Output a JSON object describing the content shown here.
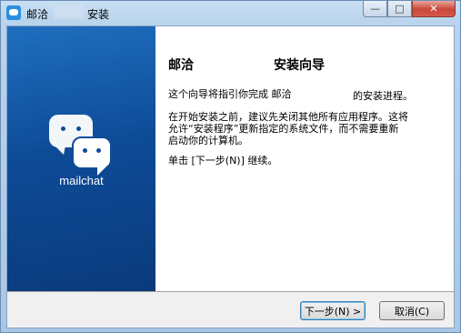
{
  "window": {
    "title_name": "邮洽",
    "title_suffix": "安装",
    "controls": {
      "minimize": "—",
      "maximize": "□",
      "close": "✕"
    }
  },
  "banner": {
    "logo_text": "mailchat"
  },
  "content": {
    "heading_name": "邮洽",
    "heading_suffix": "安装向导",
    "p1_start": "这个向导将指引你完成 邮洽",
    "p1_end": "的安装进程。",
    "p2_line1": "在开始安装之前，建议先关闭其他所有应用程序。这将",
    "p2_line2": "允许“安装程序”更新指定的系统文件，而不需要重新",
    "p2_line3": "启动你的计算机。",
    "p3": "单击 [下一步(N)] 继续。"
  },
  "buttons": {
    "next": "下一步(N) >",
    "cancel": "取消(C)"
  }
}
